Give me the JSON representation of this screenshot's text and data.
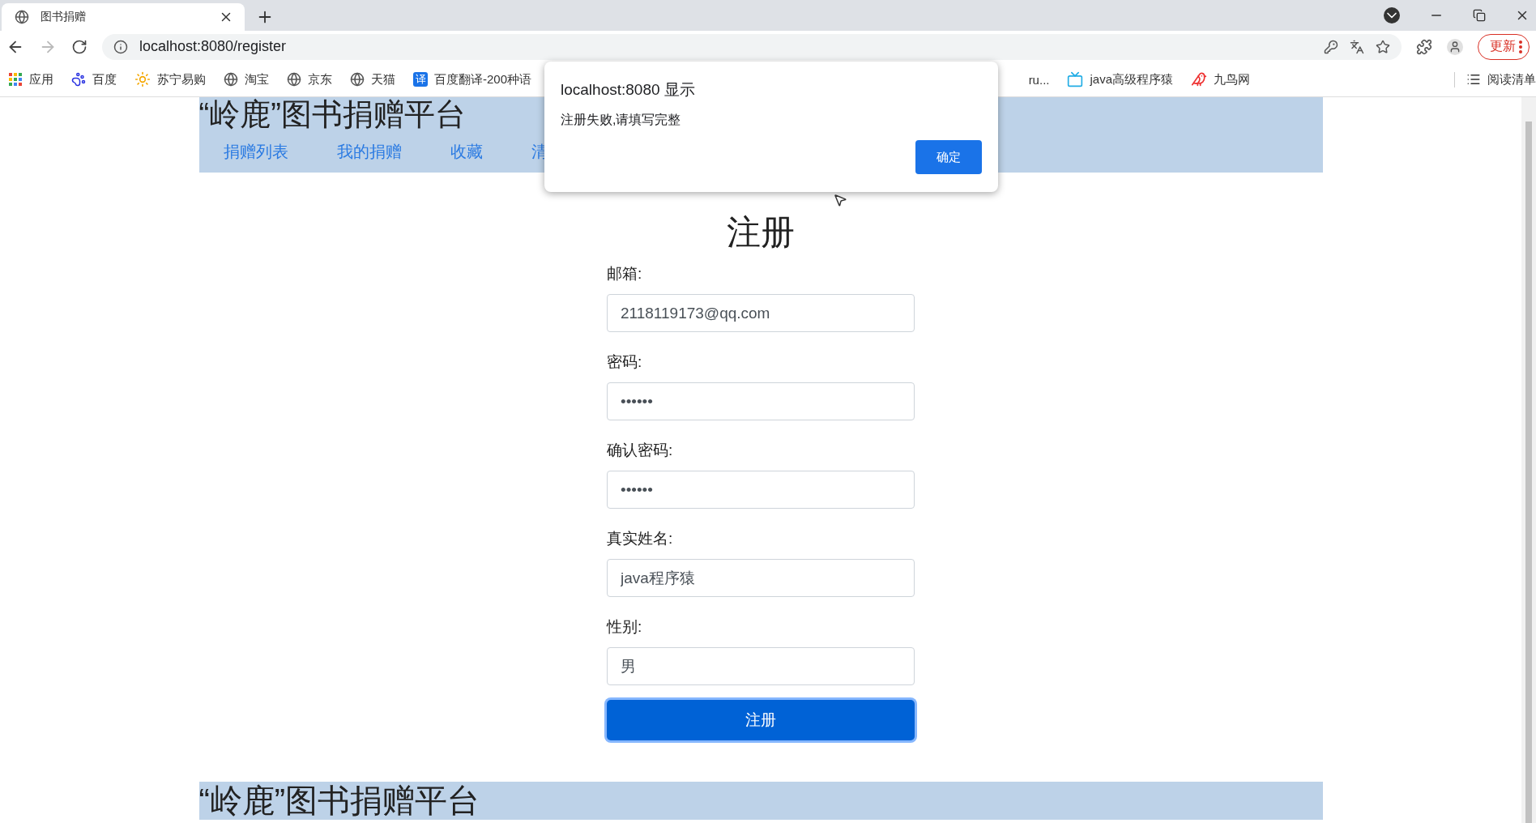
{
  "browser": {
    "tab": {
      "title": "图书捐赠"
    },
    "address": "localhost:8080/register",
    "update_button": "更新",
    "bookmarks": [
      {
        "label": "应用",
        "kind": "apps"
      },
      {
        "label": "百度",
        "kind": "paw"
      },
      {
        "label": "苏宁易购",
        "kind": "lion"
      },
      {
        "label": "淘宝",
        "kind": "globe"
      },
      {
        "label": "京东",
        "kind": "globe"
      },
      {
        "label": "天猫",
        "kind": "globe"
      },
      {
        "label": "百度翻译-200种语",
        "kind": "translate",
        "badge": "译"
      }
    ],
    "bookmarks_right": [
      {
        "label": "ru...",
        "kind": "none"
      },
      {
        "label": "java高级程序猿",
        "kind": "tv"
      },
      {
        "label": "九鸟网",
        "kind": "bird"
      }
    ],
    "reading_list": "阅读清单"
  },
  "header": {
    "title": "“岭鹿”图书捐赠平台",
    "nav": [
      "捐赠列表",
      "我的捐赠",
      "收藏",
      "清"
    ]
  },
  "form": {
    "title": "注册",
    "fields": [
      {
        "label": "邮箱:",
        "value": "2118119173@qq.com",
        "kind": "text"
      },
      {
        "label": "密码:",
        "value": "••••••",
        "kind": "password"
      },
      {
        "label": "确认密码:",
        "value": "••••••",
        "kind": "password"
      },
      {
        "label": "真实姓名:",
        "value": "java程序猿",
        "kind": "text"
      },
      {
        "label": "性别:",
        "value": "男",
        "kind": "text"
      }
    ],
    "submit": "注册"
  },
  "footer": {
    "title": "“岭鹿”图书捐赠平台"
  },
  "dialog": {
    "title": "localhost:8080 显示",
    "message": "注册失败,请填写完整",
    "ok": "确定"
  }
}
